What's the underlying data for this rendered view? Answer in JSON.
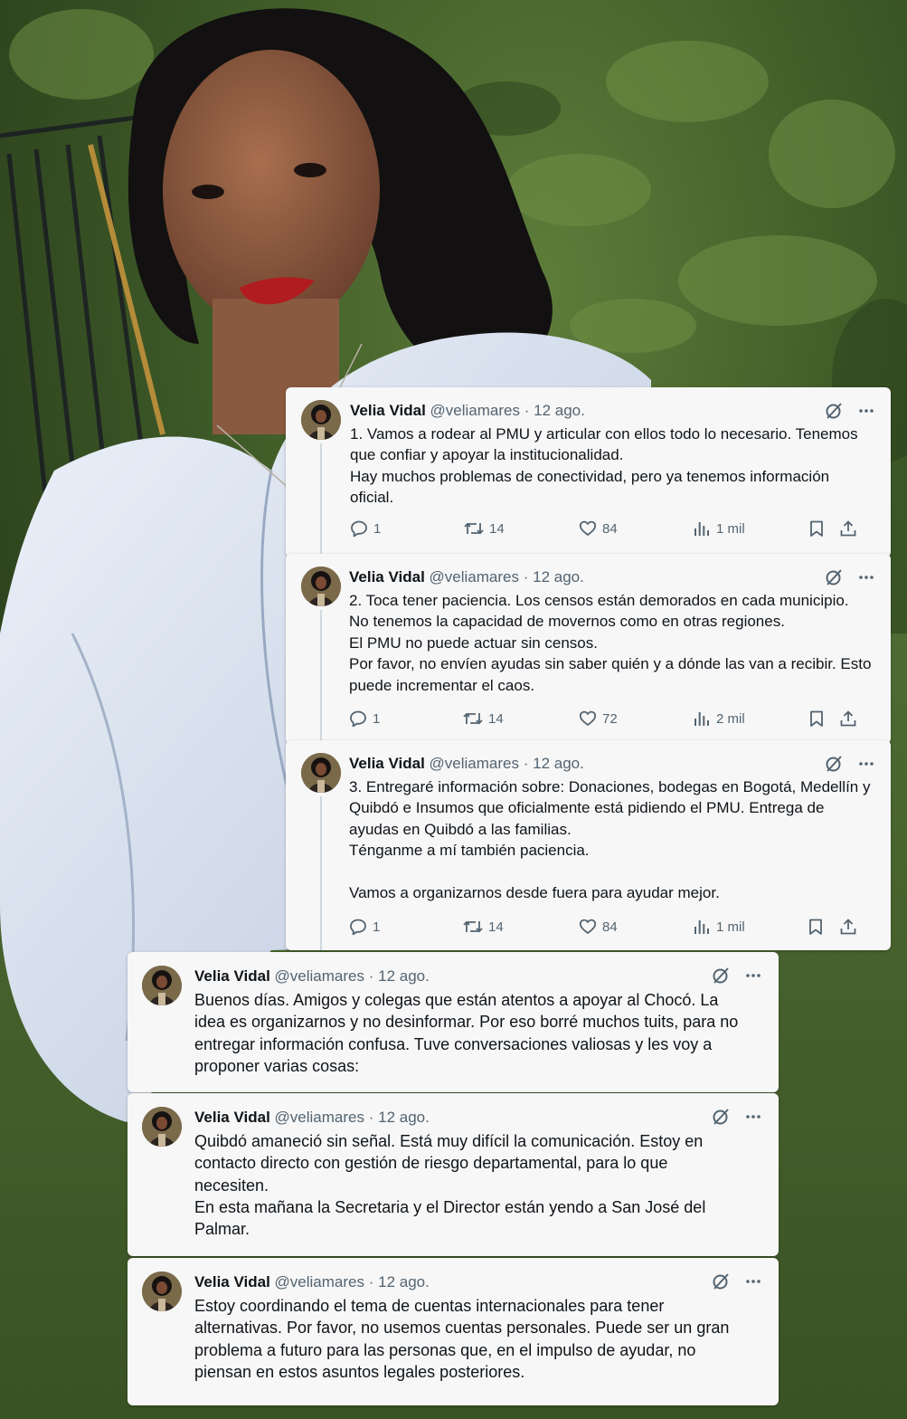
{
  "tweets": [
    {
      "name": "Velia Vidal",
      "handle": "@veliamares",
      "sep": "·",
      "date": "12 ago.",
      "text": "1. Vamos a rodear al PMU y articular con ellos todo lo necesario. Tenemos\nque confiar y apoyar la institucionalidad.\nHay muchos problemas de conectividad, pero ya tenemos información\noficial.",
      "replies": "1",
      "retweets": "14",
      "likes": "84",
      "views": "1 mil"
    },
    {
      "name": "Velia Vidal",
      "handle": "@veliamares",
      "sep": "·",
      "date": "12 ago.",
      "text": "2. Toca tener paciencia. Los censos están demorados en cada municipio.\nNo tenemos la capacidad de movernos como en otras regiones.\nEl PMU no puede actuar sin censos.\nPor favor, no envíen ayudas sin saber quién y a dónde las van a recibir. Esto\npuede incrementar el caos.",
      "replies": "1",
      "retweets": "14",
      "likes": "72",
      "views": "2 mil"
    },
    {
      "name": "Velia Vidal",
      "handle": "@veliamares",
      "sep": "·",
      "date": "12 ago.",
      "text": "3. Entregaré información sobre: Donaciones, bodegas en Bogotá, Medellín y\nQuibdó e Insumos que oficialmente está pidiendo el PMU. Entrega de\nayudas en Quibdó a las familias.\nTénganme a mí también paciencia.\n\nVamos a organizarnos desde fuera para ayudar mejor.",
      "replies": "1",
      "retweets": "14",
      "likes": "84",
      "views": "1 mil"
    },
    {
      "name": "Velia Vidal",
      "handle": "@veliamares",
      "sep": "·",
      "date": "12 ago.",
      "text": "Buenos días. Amigos y colegas que están atentos a apoyar al Chocó. La\nidea es organizarnos y no desinformar. Por eso borré muchos tuits, para no\nentregar información confusa. Tuve conversaciones valiosas y les voy a\nproponer varias cosas:"
    },
    {
      "name": "Velia Vidal",
      "handle": "@veliamares",
      "sep": "·",
      "date": "12 ago.",
      "text": "Quibdó amaneció sin señal. Está muy difícil la comunicación. Estoy en\ncontacto directo con gestión de riesgo departamental, para lo que\nnecesiten.\nEn esta mañana la Secretaria y el Director están yendo a San José del\nPalmar."
    },
    {
      "name": "Velia Vidal",
      "handle": "@veliamares",
      "sep": "·",
      "date": "12 ago.",
      "text": "Estoy coordinando el tema de cuentas internacionales para tener\nalternativas. Por favor, no usemos cuentas personales. Puede ser un gran\nproblema a futuro para las personas que, en el impulso de ayudar, no\npiensan en estos asuntos legales posteriores."
    }
  ],
  "icons": {
    "grok": "grok-icon",
    "more": "more-icon",
    "reply": "reply-icon",
    "retweet": "retweet-icon",
    "like": "like-icon",
    "views": "views-icon",
    "bookmark": "bookmark-icon",
    "share": "share-icon"
  }
}
